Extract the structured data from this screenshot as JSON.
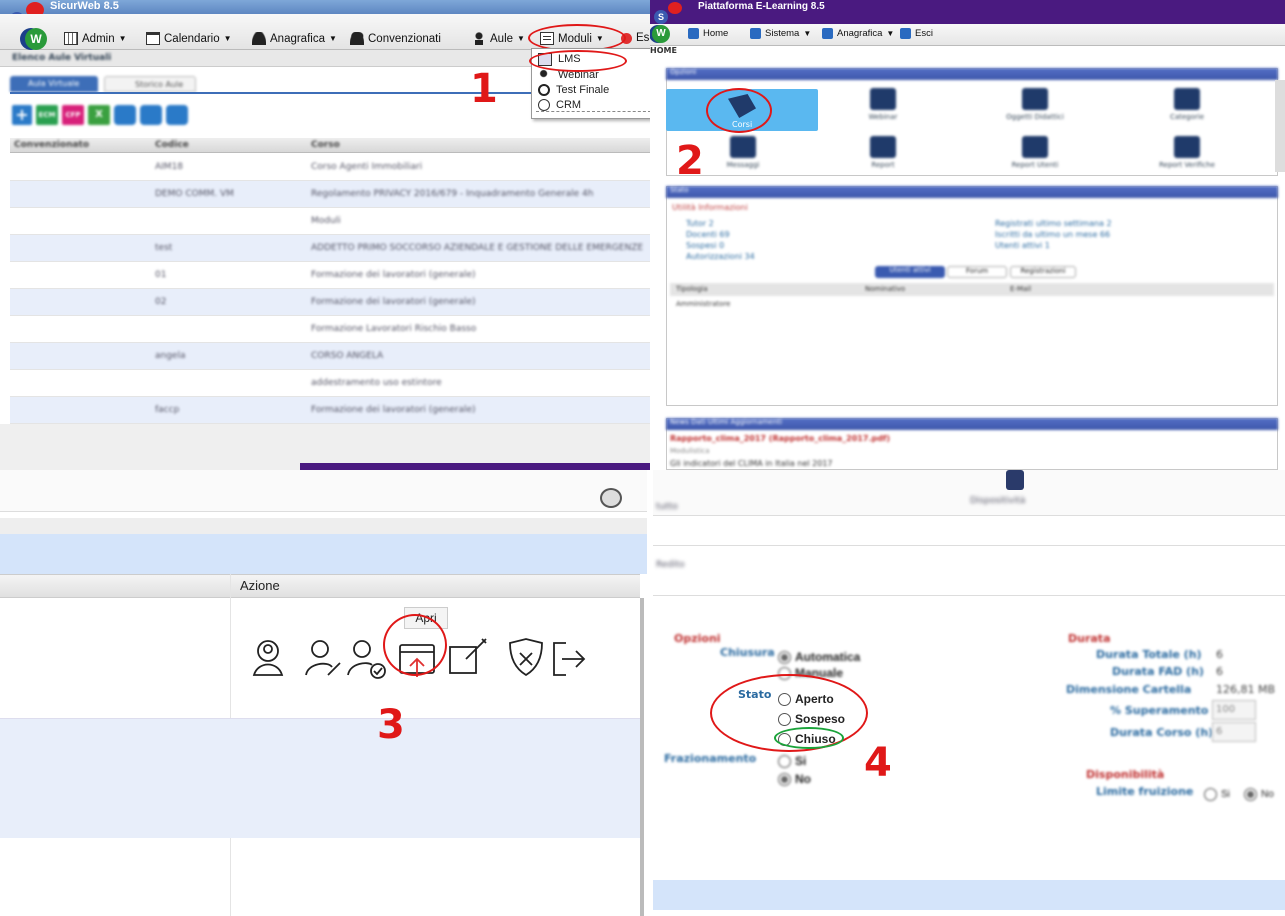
{
  "top_left": {
    "app_title": "SicurWeb 8.5",
    "menu": {
      "admin": "Admin",
      "calendario": "Calendario",
      "anagrafica": "Anagrafica",
      "convenzionati": "Convenzionati",
      "aule": "Aule",
      "moduli": "Moduli",
      "esci": "Es"
    },
    "dropdown": [
      "LMS",
      "Webinar",
      "Test Finale",
      "CRM"
    ],
    "section_title": "Elenco Aule Virtuali",
    "tabs": [
      "Aula Virtuale",
      "Storico Aule"
    ],
    "toolbar": [
      "+",
      "ECM",
      "CFP",
      "X"
    ],
    "columns": [
      "Convenzionato",
      "Codice",
      "Corso"
    ],
    "rows": [
      {
        "codice": "AIM18",
        "corso": "Corso Agenti Immobiliari"
      },
      {
        "codice": "DEMO COMM. VM",
        "corso": "Regolamento PRIVACY 2016/679 - Inquadramento Generale 4h"
      },
      {
        "codice": "",
        "corso": "Moduli"
      },
      {
        "codice": "test",
        "corso": "ADDETTO PRIMO SOCCORSO AZIENDALE E GESTIONE DELLE EMERGENZE"
      },
      {
        "codice": "01",
        "corso": "Formazione dei lavoratori (generale)"
      },
      {
        "codice": "02",
        "corso": "Formazione dei lavoratori (generale)"
      },
      {
        "codice": "",
        "corso": "Formazione Lavoratori Rischio Basso"
      },
      {
        "codice": "angela",
        "corso": "CORSO ANGELA"
      },
      {
        "codice": "",
        "corso": "addestramento uso estintore"
      },
      {
        "codice": "faccp",
        "corso": "Formazione dei lavoratori (generale)"
      }
    ],
    "step": "1"
  },
  "top_right": {
    "app_title": "Piattaforma E-Learning 8.5",
    "menu": {
      "home": "Home",
      "sistema": "Sistema",
      "anagrafica": "Anagrafica",
      "esci": "Esci"
    },
    "breadcrumb": "HOME",
    "options_title": "Opzioni",
    "options": [
      "Corsi",
      "Webinar",
      "Oggetti Didattici",
      "Categorie",
      "Messaggi",
      "Report",
      "Report Utenti",
      "Report Verifiche"
    ],
    "stats_title": "Stato",
    "stats_sub": "Utilità Informazioni",
    "stats": [
      "Tutor 2",
      "Docenti 69",
      "Sospesi 0",
      "Autorizzazioni 34",
      "Registrati ultimo settimana 2",
      "Iscritti da ultimo un mese 66",
      "Utenti attivi 1"
    ],
    "stat_tabs": [
      "Utenti attivi",
      "Forum",
      "Registrazioni"
    ],
    "stat_cols": [
      "Tipologia",
      "Nominativo",
      "E-Mail"
    ],
    "stat_row": "Amministratore",
    "news_title": "News Dati Ultimi Aggiornamenti",
    "news_link": "Rapporto_clima_2017 (Rapporto_clima_2017.pdf)",
    "news_cat": "Modulistica",
    "news_text": "Gli indicatori del CLIMA in Italia nel 2017",
    "step": "2"
  },
  "bottom_left": {
    "column_header": "Azione",
    "tooltip": "Apri",
    "step": "3"
  },
  "bottom_right": {
    "top_label": "Dispositività",
    "row1": "tutto",
    "row2": "Redito",
    "opzioni": "Opzioni",
    "chiusura": "Chiusura",
    "chiusura_opts": [
      "Automatica",
      "Manuale"
    ],
    "stato": "Stato",
    "stato_opts": [
      "Aperto",
      "Sospeso",
      "Chiuso"
    ],
    "frazionamento": "Frazionamento",
    "fraz_opts": [
      "Si",
      "No"
    ],
    "durata": "Durata",
    "durata_totale": "Durata Totale (h)",
    "durata_totale_val": "6",
    "durata_fad": "Durata FAD (h)",
    "durata_fad_val": "6",
    "dimensione": "Dimensione Cartella",
    "dimensione_val": "126,81 MB",
    "superamento": "% Superamento",
    "superamento_val": "100",
    "durata_corso": "Durata Corso (h)",
    "durata_corso_val": "6",
    "disponibilita": "Disponibilità",
    "limite": "Limite fruizione",
    "limite_opts": [
      "Si",
      "No"
    ],
    "step": "4"
  }
}
